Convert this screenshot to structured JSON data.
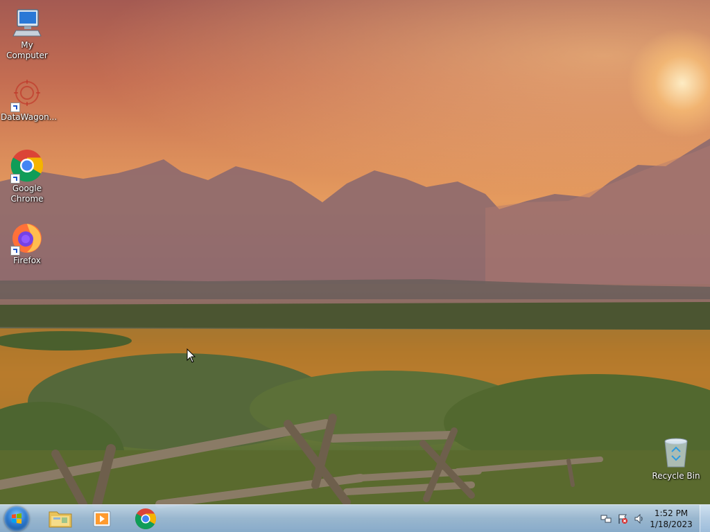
{
  "desktop": {
    "icons": [
      {
        "label": "My Computer",
        "icon": "computer-icon"
      },
      {
        "label": "DataWagon...",
        "icon": "datawagon-icon"
      },
      {
        "label": "Google Chrome",
        "icon": "chrome-icon"
      },
      {
        "label": "Firefox",
        "icon": "firefox-icon"
      },
      {
        "label": "Recycle Bin",
        "icon": "recycle-bin-icon"
      }
    ]
  },
  "taskbar": {
    "start_icon": "windows-start-icon",
    "pinned": [
      {
        "icon": "file-explorer-icon"
      },
      {
        "icon": "media-player-icon"
      },
      {
        "icon": "chrome-icon"
      }
    ],
    "tray": {
      "icons": [
        "network-icon",
        "action-center-flag-icon",
        "volume-icon"
      ],
      "time": "1:52 PM",
      "date": "1/18/2023"
    }
  },
  "colors": {
    "taskbar": "#a9c4e0",
    "sky_top": "#a45a52",
    "sky_glow": "#e59b5e",
    "field": "#c88230"
  }
}
